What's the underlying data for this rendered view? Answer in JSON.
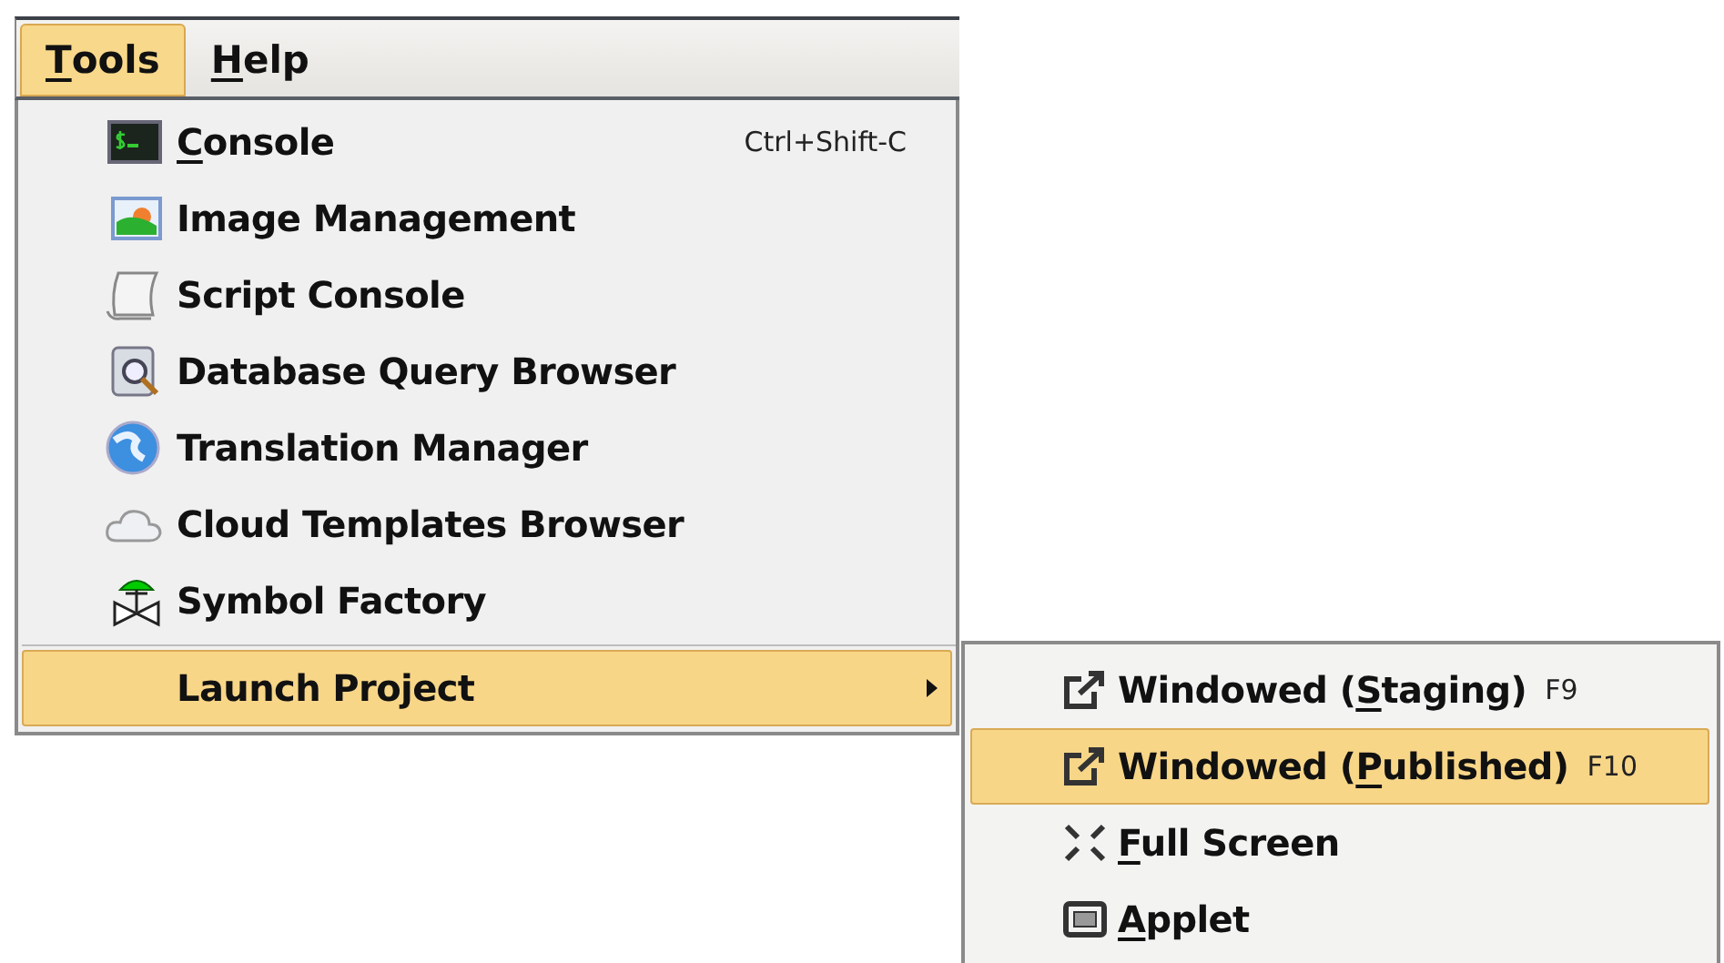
{
  "menu_bar": [
    {
      "label": [
        {
          "text": "T",
          "underlined": true
        },
        {
          "text": "ools",
          "underlined": false
        }
      ],
      "selected": true
    },
    {
      "label": [
        {
          "text": "H",
          "underlined": true
        },
        {
          "text": "elp",
          "underlined": false
        }
      ],
      "selected": false
    }
  ],
  "tools_menu": {
    "items": [
      {
        "label": [
          {
            "text": "C",
            "underlined": true
          },
          {
            "text": "onsole",
            "underlined": false
          }
        ],
        "shortcut": "Ctrl+Shift-C",
        "selected": false
      },
      {
        "label": [
          {
            "text": "Image Management",
            "underlined": false
          }
        ],
        "selected": false
      },
      {
        "label": [
          {
            "text": "Script Console",
            "underlined": false
          }
        ],
        "selected": false
      },
      {
        "label": [
          {
            "text": "Database Query Browser",
            "underlined": false
          }
        ],
        "selected": false
      },
      {
        "label": [
          {
            "text": "Translation Manager",
            "underlined": false
          }
        ],
        "selected": false
      },
      {
        "label": [
          {
            "text": "Cloud Templates Browser",
            "underlined": false
          }
        ],
        "selected": false
      },
      {
        "label": [
          {
            "text": "Symbol Factory",
            "underlined": false
          }
        ],
        "selected": false
      }
    ],
    "submenu_item": {
      "label": [
        {
          "text": "Launch Project",
          "underlined": false
        }
      ],
      "selected": true,
      "expanded": true
    }
  },
  "launch_submenu": [
    {
      "label": [
        {
          "text": "Windowed (",
          "underlined": false
        },
        {
          "text": "S",
          "underlined": true
        },
        {
          "text": "taging)",
          "underlined": false
        }
      ],
      "shortcut": "F9",
      "selected": false
    },
    {
      "label": [
        {
          "text": "Windowed (",
          "underlined": false
        },
        {
          "text": "P",
          "underlined": true
        },
        {
          "text": "ublished)",
          "underlined": false
        }
      ],
      "shortcut": "F10",
      "selected": true
    },
    {
      "label": [
        {
          "text": "F",
          "underlined": true
        },
        {
          "text": "ull Screen",
          "underlined": false
        }
      ],
      "selected": false
    },
    {
      "label": [
        {
          "text": "A",
          "underlined": true
        },
        {
          "text": "pplet",
          "underlined": false
        }
      ],
      "selected": false
    }
  ]
}
